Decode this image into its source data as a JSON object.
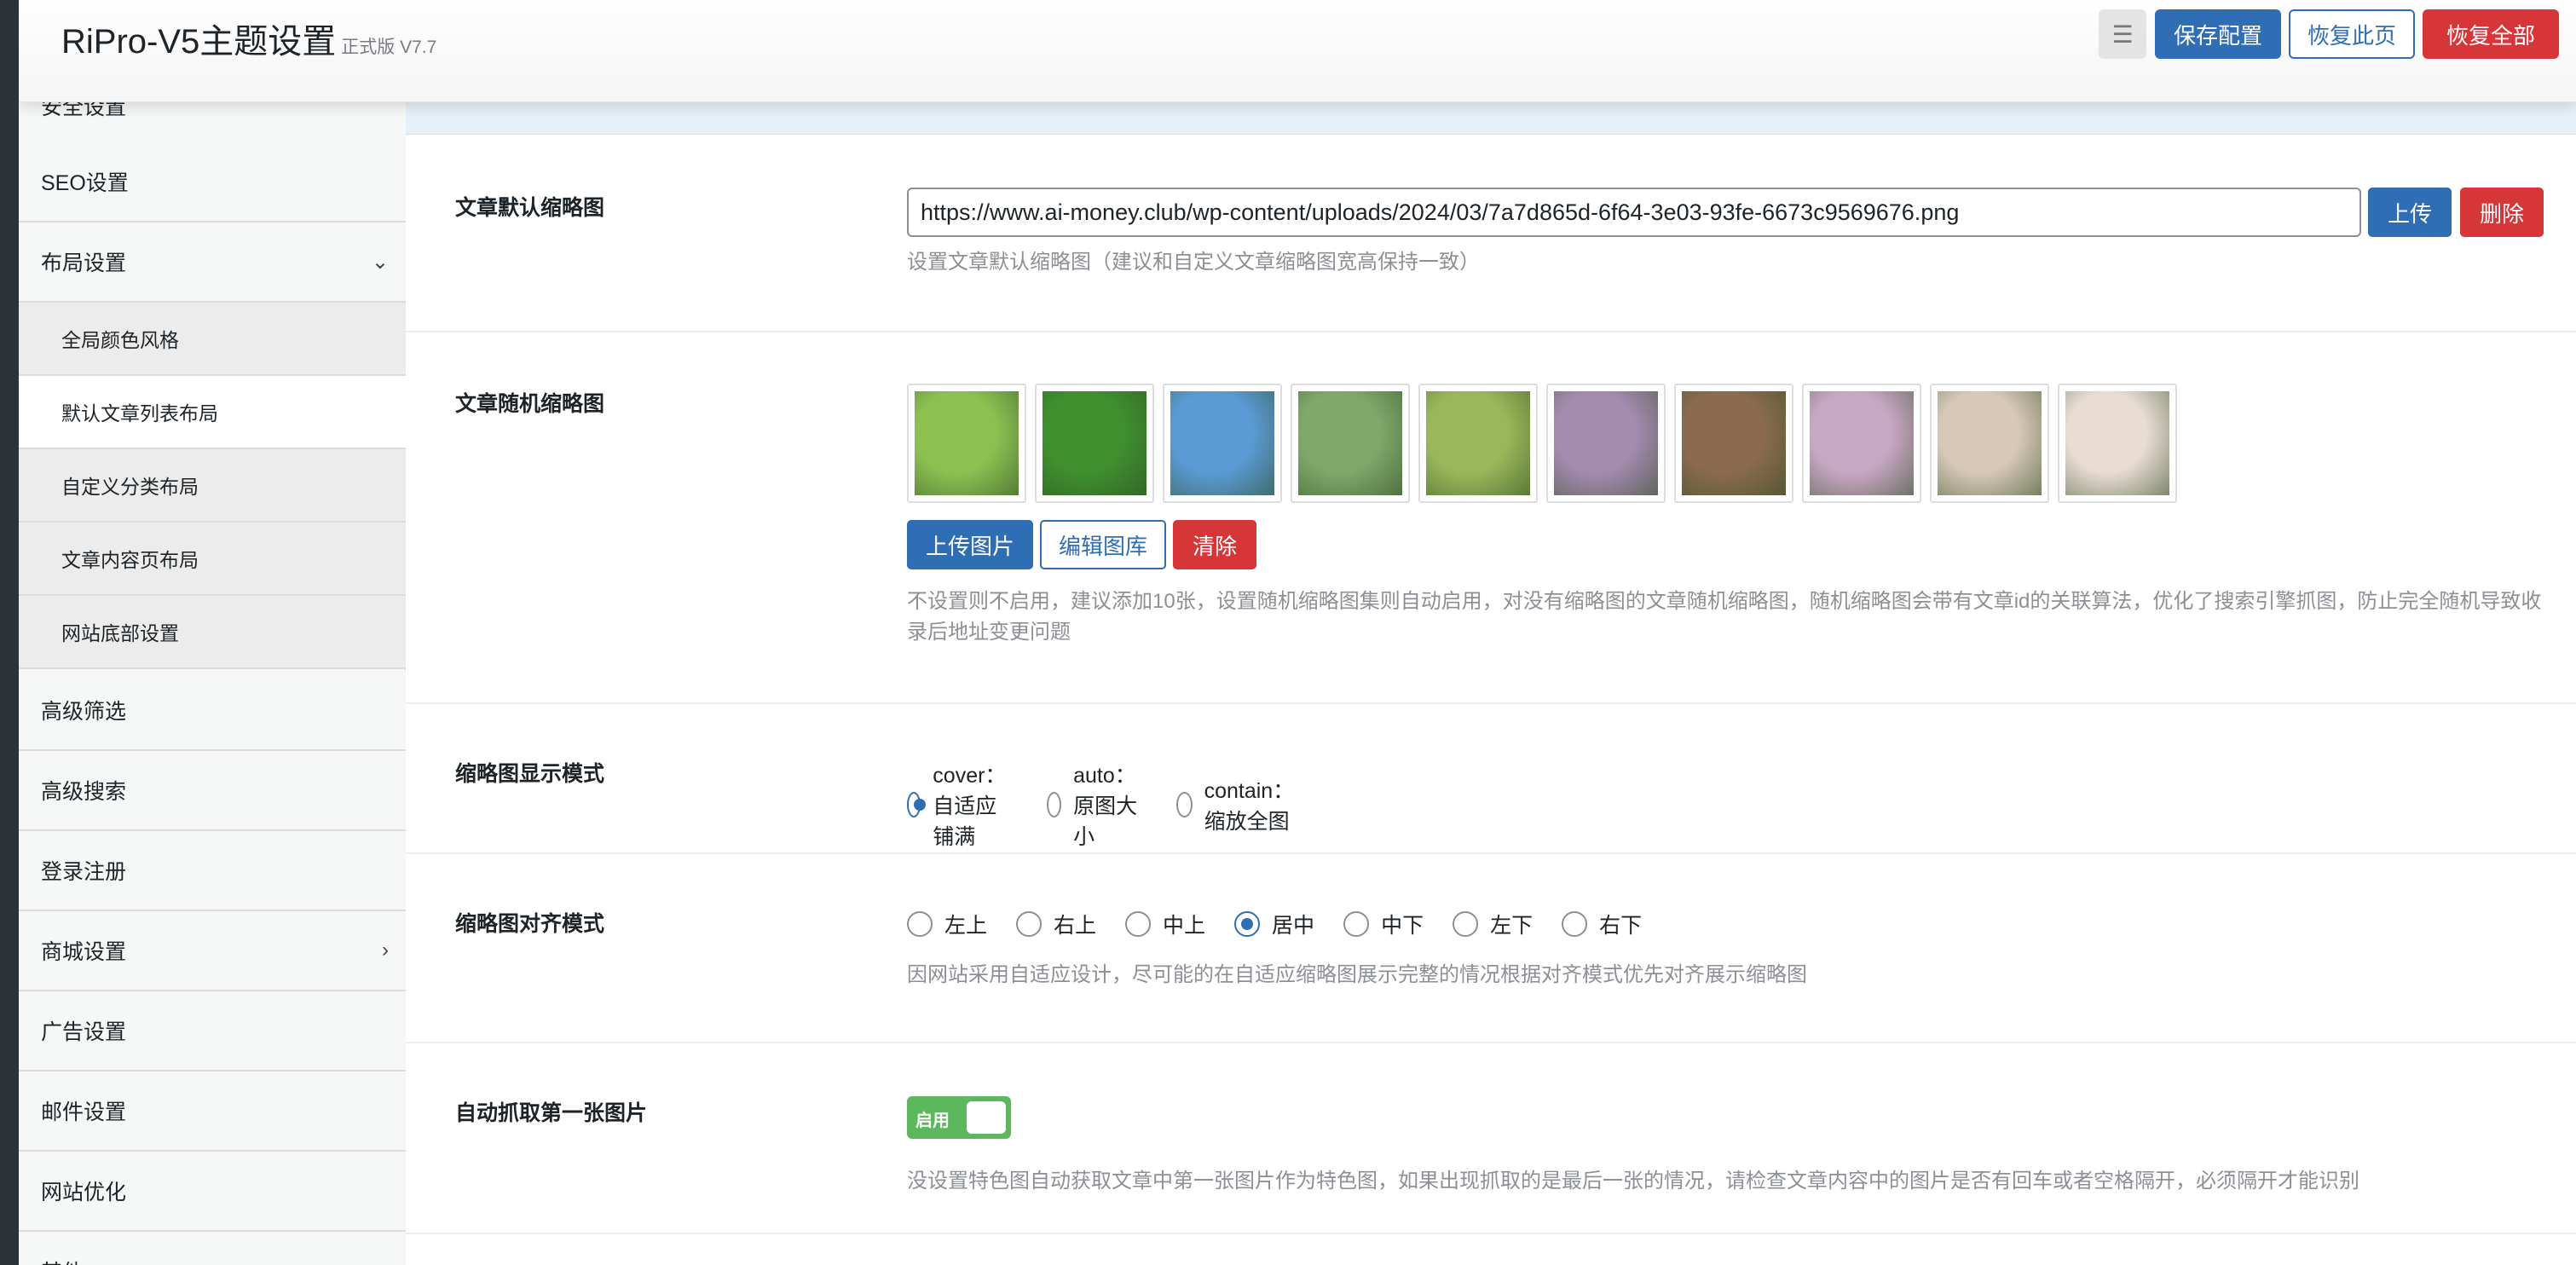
{
  "header": {
    "title": "RiPro-V5主题设置",
    "version": "正式版 V7.7",
    "menu_icon": "list-indent-icon",
    "save_label": "保存配置",
    "reset_page_label": "恢复此页",
    "reset_all_label": "恢复全部"
  },
  "sidebar": {
    "items": [
      {
        "label": "安全设置"
      },
      {
        "label": "SEO设置"
      },
      {
        "label": "布局设置",
        "chevron": "⌄"
      },
      {
        "label": "全局颜色风格"
      },
      {
        "label": "默认文章列表布局"
      },
      {
        "label": "自定义分类布局"
      },
      {
        "label": "文章内容页布局"
      },
      {
        "label": "网站底部设置"
      },
      {
        "label": "高级筛选"
      },
      {
        "label": "高级搜索"
      },
      {
        "label": "登录注册"
      },
      {
        "label": "商城设置",
        "chevron": "›"
      },
      {
        "label": "广告设置"
      },
      {
        "label": "邮件设置"
      },
      {
        "label": "网站优化"
      },
      {
        "label": "其他"
      }
    ]
  },
  "settings": {
    "default_thumb": {
      "label": "文章默认缩略图",
      "url": "https://www.ai-money.club/wp-content/uploads/2024/03/7a7d865d-6f64-3e03-93fe-6673c9569676.png",
      "upload_label": "上传",
      "delete_label": "删除",
      "desc": "设置文章默认缩略图（建议和自定义文章缩略图宽高保持一致）"
    },
    "random_thumb": {
      "label": "文章随机缩略图",
      "upload_label": "上传图片",
      "edit_label": "编辑图库",
      "clear_label": "清除",
      "desc": "不设置则不启用，建议添加10张，设置随机缩略图集则自动启用，对没有缩略图的文章随机缩略图，随机缩略图会带有文章id的关联算法，优化了搜索引擎抓图，防止完全随机导致收录后地址变更问题",
      "colors": [
        "#8cc152",
        "#3f8f2f",
        "#5b9bd5",
        "#7fa86a",
        "#9ab85a",
        "#a58bb0",
        "#8b6b4f",
        "#c8a7c4",
        "#d8c8b8",
        "#e9dcd3"
      ]
    },
    "display_mode": {
      "label": "缩略图显示模式",
      "options": [
        "cover：自适应铺满",
        "auto：原图大小",
        "contain：缩放全图"
      ],
      "selected": 0
    },
    "align_mode": {
      "label": "缩略图对齐模式",
      "options": [
        "左上",
        "右上",
        "中上",
        "居中",
        "中下",
        "左下",
        "右下"
      ],
      "selected": 3,
      "desc": "因网站采用自适应设计，尽可能的在自适应缩略图展示完整的情况根据对齐模式优先对齐展示缩略图"
    },
    "auto_first_image": {
      "label": "自动抓取第一张图片",
      "toggle_label": "启用",
      "enabled": true,
      "desc": "没设置特色图自动获取文章中第一张图片作为特色图，如果出现抓取的是最后一张的情况，请检查文章内容中的图片是否有回车或者空格隔开，必须隔开才能识别"
    }
  }
}
